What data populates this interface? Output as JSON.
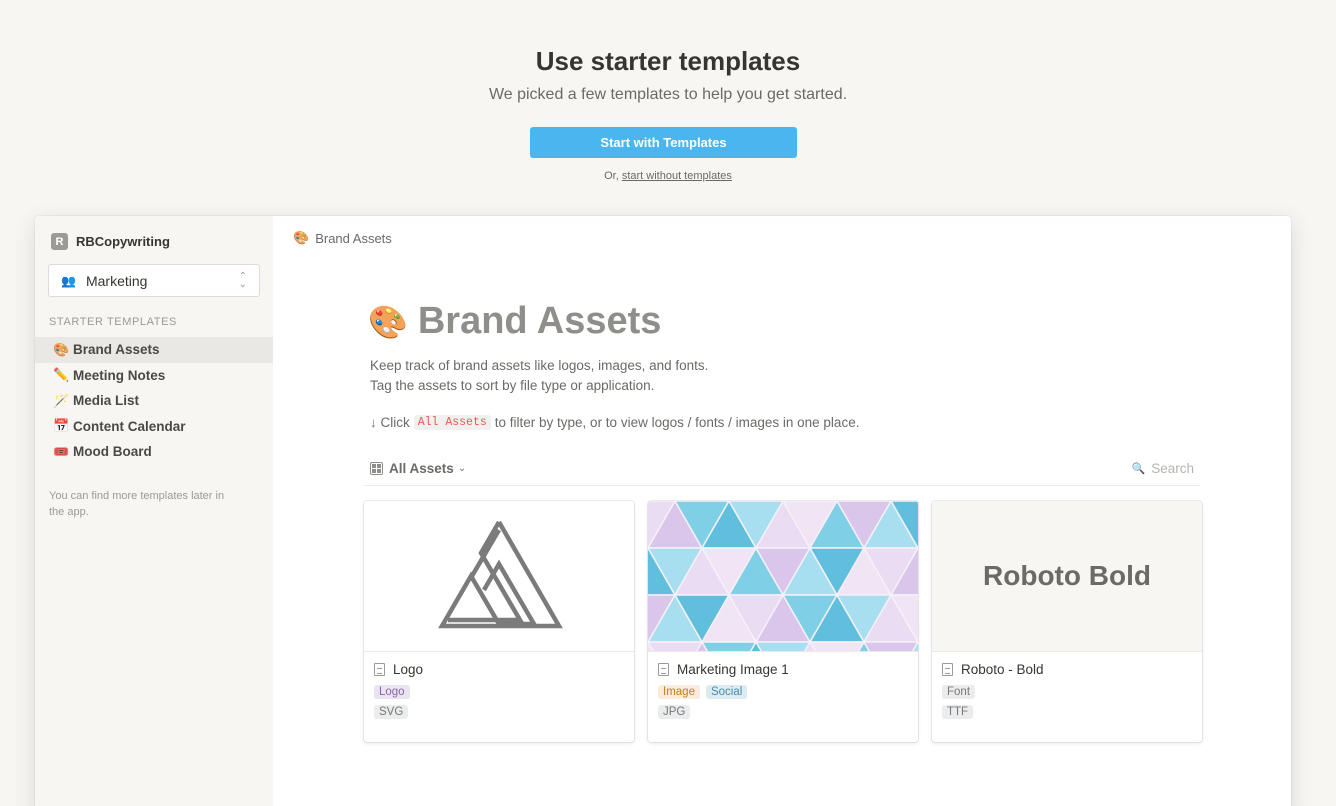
{
  "hero": {
    "title": "Use starter templates",
    "subtitle": "We picked a few templates to help you get started.",
    "start_button": "Start with Templates",
    "or_prefix": "Or, ",
    "skip_link": "start without templates"
  },
  "sidebar": {
    "workspace_initial": "R",
    "workspace_name": "RBCopywriting",
    "team_icon": "👥",
    "team_select": "Marketing",
    "section_label": "Starter templates",
    "items": [
      {
        "emoji": "🎨",
        "label": "Brand Assets"
      },
      {
        "emoji": "✏️",
        "label": "Meeting Notes"
      },
      {
        "emoji": "🪄",
        "label": "Media List"
      },
      {
        "emoji": "📅",
        "label": "Content Calendar"
      },
      {
        "emoji": "🎟️",
        "label": "Mood Board"
      }
    ],
    "note": "You can find more templates later in the app."
  },
  "main": {
    "breadcrumb_emoji": "🎨",
    "breadcrumb": "Brand Assets",
    "title_emoji": "🎨",
    "title": "Brand Assets",
    "desc_line1": "Keep track of brand assets like logos, images, and fonts.",
    "desc_line2": "Tag the assets to sort by file type or application.",
    "hint_prefix": "↓ Click",
    "hint_code": "All Assets",
    "hint_suffix": "to filter by type, or to view logos / fonts / images in one place.",
    "view_label": "All Assets",
    "search_icon": "🔍",
    "search_label": "Search",
    "cards": [
      {
        "title": "Logo",
        "tags": [
          {
            "label": "Logo",
            "bg": "#eae4f2",
            "color": "#8a67ab"
          }
        ],
        "type": "SVG"
      },
      {
        "title": "Marketing Image 1",
        "tags": [
          {
            "label": "Image",
            "bg": "#faebdd",
            "color": "#c4801e"
          },
          {
            "label": "Social",
            "bg": "#ddebf1",
            "color": "#4b8ab0"
          }
        ],
        "type": "JPG"
      },
      {
        "title": "Roboto - Bold",
        "cover_text": "Roboto Bold",
        "tags": [
          {
            "label": "Font",
            "bg": "#ebeced",
            "color": "#787774"
          }
        ],
        "type": "TTF"
      }
    ]
  }
}
